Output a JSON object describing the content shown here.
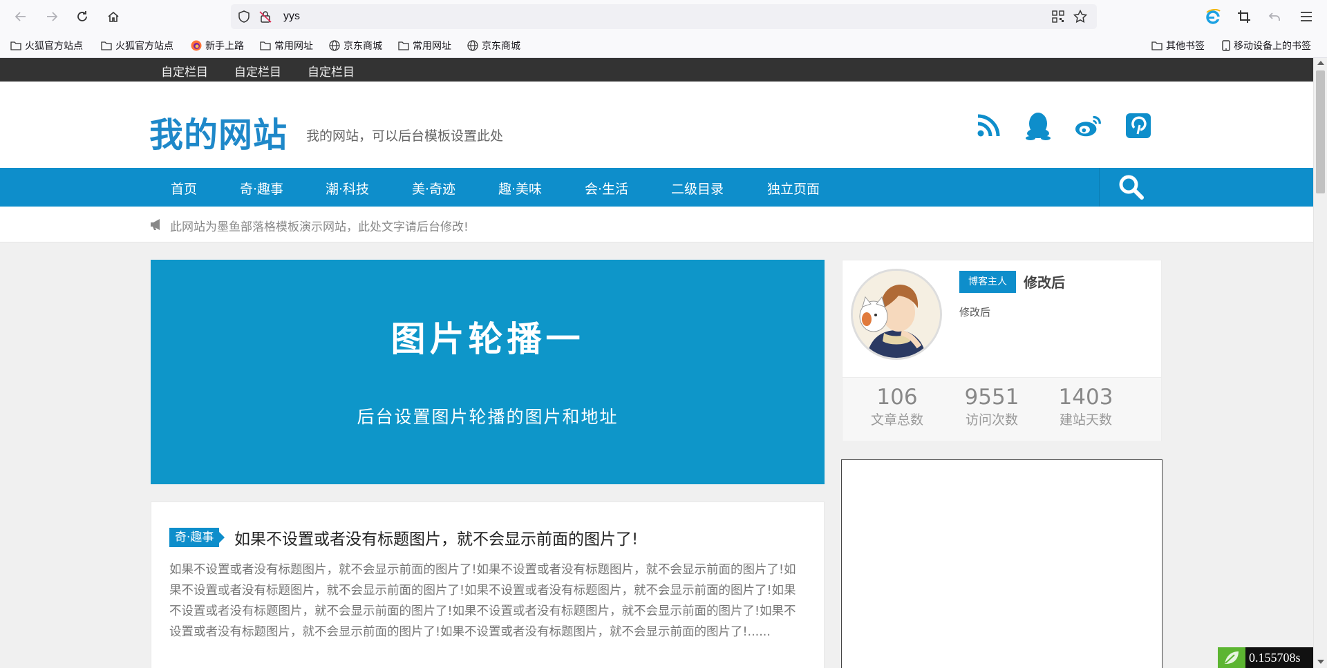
{
  "browser": {
    "url": "yys",
    "bookmarks": [
      {
        "label": "火狐官方站点",
        "icon": "folder-icon"
      },
      {
        "label": "火狐官方站点",
        "icon": "folder-icon"
      },
      {
        "label": "新手上路",
        "icon": "firefox-icon"
      },
      {
        "label": "常用网址",
        "icon": "folder-icon"
      },
      {
        "label": "京东商城",
        "icon": "globe-icon"
      },
      {
        "label": "常用网址",
        "icon": "folder-icon"
      },
      {
        "label": "京东商城",
        "icon": "globe-icon"
      }
    ],
    "other_bookmarks": "其他书签",
    "mobile_bookmarks": "移动设备上的书签"
  },
  "site": {
    "topbar": [
      "自定栏目",
      "自定栏目",
      "自定栏目"
    ],
    "logo": "我的网站",
    "tagline": "我的网站，可以后台模板设置此处",
    "nav": [
      "首页",
      "奇·趣事",
      "潮·科技",
      "美·奇迹",
      "趣·美味",
      "会·生活",
      "二级目录",
      "独立页面"
    ],
    "notice": "此网站为墨鱼部落格模板演示网站，此处文字请后台修改!",
    "slider": {
      "title": "图片轮播一",
      "subtitle": "后台设置图片轮播的图片和地址"
    },
    "post": {
      "category": "奇·趣事",
      "title": "如果不设置或者没有标题图片，就不会显示前面的图片了!",
      "excerpt": "如果不设置或者没有标题图片，就不会显示前面的图片了!如果不设置或者没有标题图片，就不会显示前面的图片了!如果不设置或者没有标题图片，就不会显示前面的图片了!如果不设置或者没有标题图片，就不会显示前面的图片了!如果不设置或者没有标题图片，就不会显示前面的图片了!如果不设置或者没有标题图片，就不会显示前面的图片了!如果不设置或者没有标题图片，就不会显示前面的图片了!如果不设置或者没有标题图片，就不会显示前面的图片了!......"
    },
    "profile": {
      "badge": "博客主人",
      "name": "修改后",
      "desc": "修改后",
      "stats": [
        {
          "num": "106",
          "label": "文章总数"
        },
        {
          "num": "9551",
          "label": "访问次数"
        },
        {
          "num": "1403",
          "label": "建站天数"
        }
      ]
    },
    "timer": "0.155708s",
    "accent_color": "#0e8ecb"
  }
}
